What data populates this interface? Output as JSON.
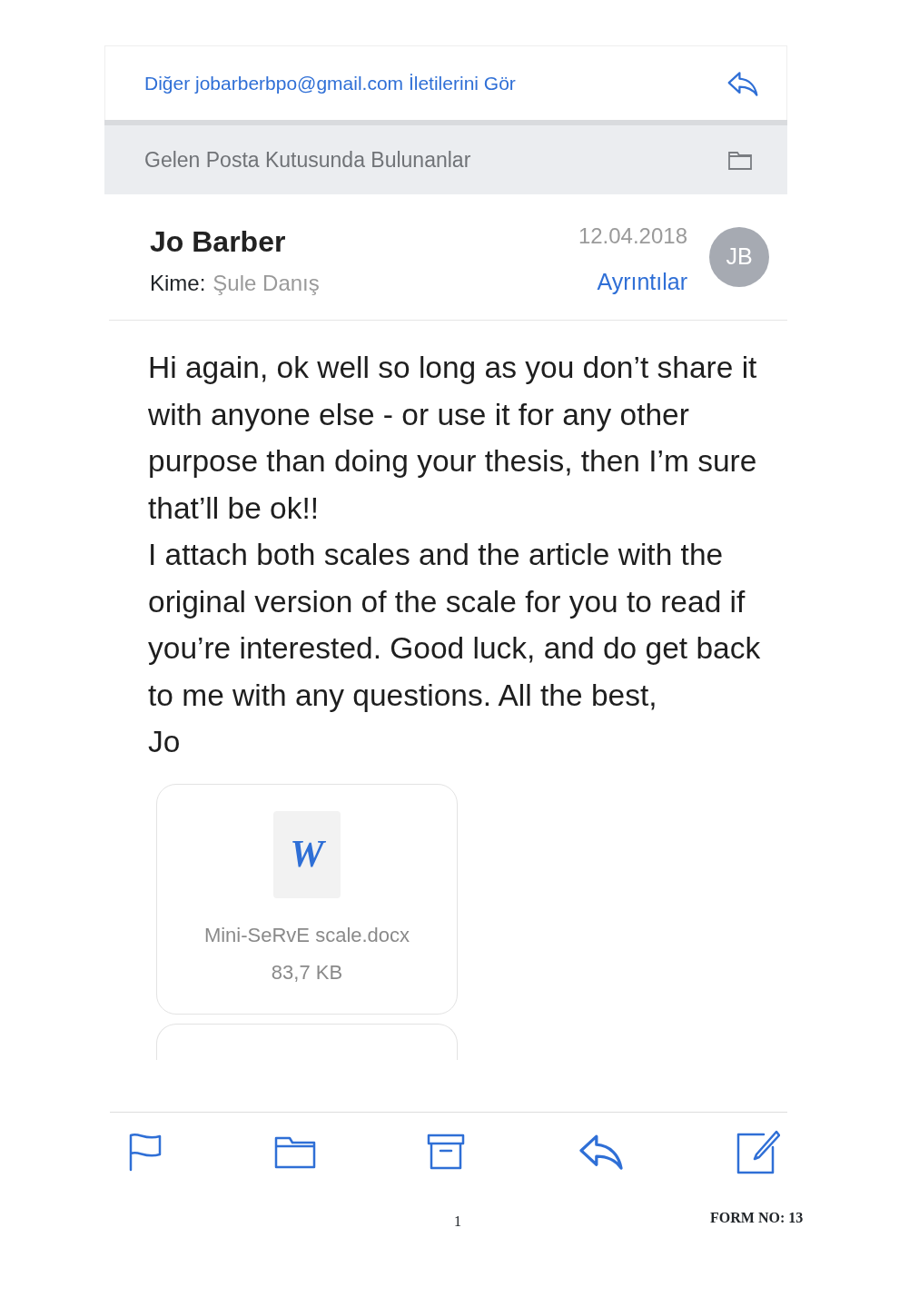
{
  "header_link": "Diğer jobarberbpo@gmail.com İletilerini Gör",
  "mailbox_bar": "Gelen Posta Kutusunda Bulunanlar",
  "message": {
    "sender": "Jo Barber",
    "date": "12.04.2018",
    "avatar": "JB",
    "to_label": "Kime:",
    "recipient": "Şule Danış",
    "details_link": "Ayrıntılar"
  },
  "body": [
    "Hi again, ok well so long as you don’t share it with anyone else - or use it for any other purpose than doing your thesis, then I’m sure that’ll be ok!!",
    "I attach both scales and the article with the original version of the scale for you to read if you’re interested.  Good luck, and do get back to me with any questions.  All the best,",
    "Jo"
  ],
  "attachments": [
    {
      "icon_letter": "W",
      "filename": "Mini-SeRvE scale.docx",
      "size": "83,7 KB"
    }
  ],
  "footer": {
    "page_number": "1",
    "form_number": "FORM NO: 13"
  }
}
